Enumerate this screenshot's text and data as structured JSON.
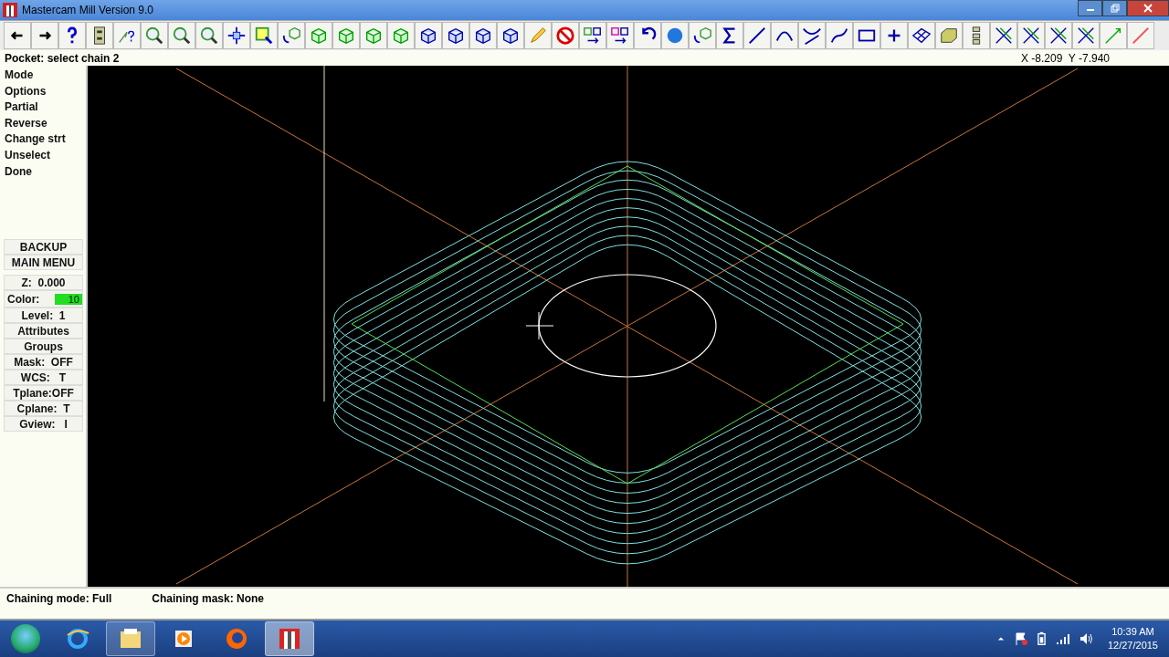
{
  "window": {
    "title": "Mastercam Mill Version 9.0"
  },
  "prompt": "Pocket: select chain 2",
  "coordinates": "X -8.209  Y -7.940",
  "menu": {
    "items": [
      "Mode",
      "Options",
      "Partial",
      "Reverse",
      "Change strt",
      "Unselect",
      "Done"
    ]
  },
  "navigation": [
    "BACKUP",
    "MAIN MENU"
  ],
  "settings": [
    {
      "kind": "plain",
      "label": "Z:  0.000"
    },
    {
      "kind": "color",
      "label": "Color:",
      "value": "10",
      "color": "#22dd22"
    },
    {
      "kind": "plain",
      "label": "Level:  1"
    },
    {
      "kind": "plain",
      "label": "Attributes"
    },
    {
      "kind": "plain",
      "label": "Groups"
    },
    {
      "kind": "plain",
      "label": "Mask:  OFF"
    },
    {
      "kind": "plain",
      "label": "WCS:   T"
    },
    {
      "kind": "plain",
      "label": "Tplane:OFF"
    },
    {
      "kind": "plain",
      "label": "Cplane:  T"
    },
    {
      "kind": "plain",
      "label": "Gview:   I"
    }
  ],
  "status_bar": {
    "chaining_mode": "Chaining mode: Full",
    "chaining_mask": "Chaining mask: None"
  },
  "taskbar": {
    "apps": [
      {
        "kind": "browser",
        "open": false,
        "selected": false
      },
      {
        "kind": "folder",
        "open": true,
        "selected": false
      },
      {
        "kind": "media",
        "open": false,
        "selected": false
      },
      {
        "kind": "firefox",
        "open": false,
        "selected": false
      },
      {
        "kind": "mastercam",
        "open": true,
        "selected": true
      }
    ],
    "time": "10:39 AM",
    "date": "12/27/2015"
  }
}
